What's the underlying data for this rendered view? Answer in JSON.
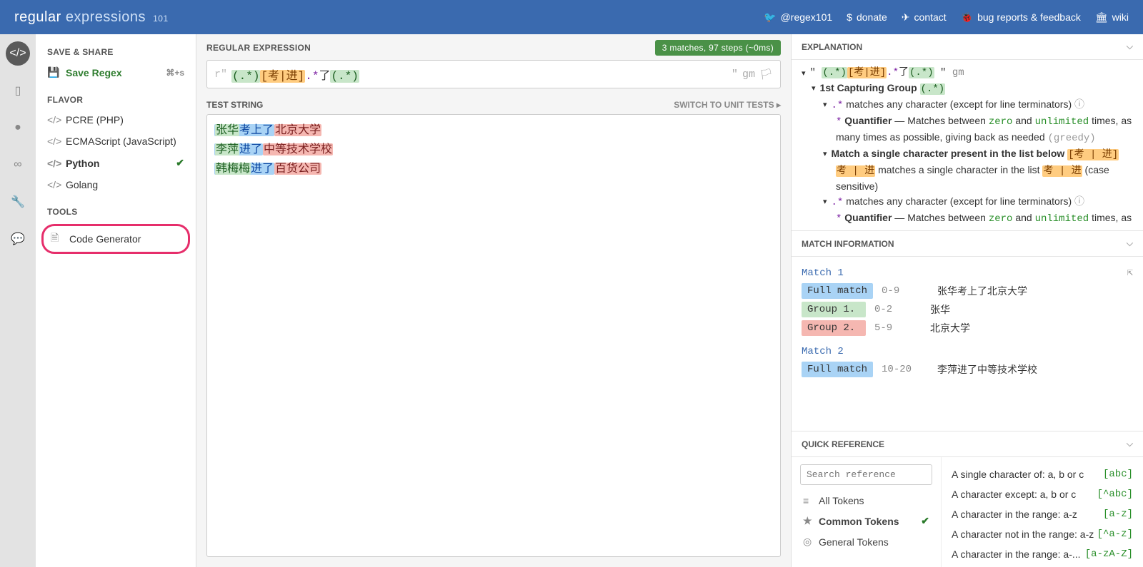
{
  "header": {
    "logo_main": "regular",
    "logo_light": "expressions",
    "logo_sub": "101",
    "links": [
      {
        "icon": "🐦",
        "label": "@regex101"
      },
      {
        "icon": "$",
        "label": "donate"
      },
      {
        "icon": "✈",
        "label": "contact"
      },
      {
        "icon": "🐞",
        "label": "bug reports & feedback"
      },
      {
        "icon": "🏛",
        "label": "wiki"
      }
    ]
  },
  "sidebar": {
    "save_share": "SAVE & SHARE",
    "save_regex": "Save Regex",
    "save_kbd": "⌘+s",
    "flavor": "FLAVOR",
    "flavors": [
      {
        "label": "PCRE (PHP)",
        "active": false
      },
      {
        "label": "ECMAScript (JavaScript)",
        "active": false
      },
      {
        "label": "Python",
        "active": true
      },
      {
        "label": "Golang",
        "active": false
      }
    ],
    "tools": "TOOLS",
    "code_gen": "Code Generator"
  },
  "editor": {
    "title": "REGULAR EXPRESSION",
    "badge": "3 matches, 97 steps (~0ms)",
    "prefix": "r\"",
    "regex_display": {
      "g1": "(.*)",
      "cls": "[考|进]",
      "mid": ".*",
      "lit": "了",
      "g2": "(.*)"
    },
    "flags": "gm",
    "test_title": "TEST STRING",
    "switch": "SWITCH TO UNIT TESTS ▸",
    "test_lines": [
      {
        "g1": "张华",
        "cls": "考",
        "mid": "上",
        "lit": "了",
        "g2": "北京大学"
      },
      {
        "g1": "李萍",
        "cls": "进",
        "mid": "",
        "lit": "了",
        "g2": "中等技术学校"
      },
      {
        "g1": "韩梅梅",
        "cls": "进",
        "mid": "",
        "lit": "了",
        "g2": "百货公司"
      }
    ]
  },
  "explanation": {
    "title": "EXPLANATION",
    "pattern_quoted": "\" (.*)[考|进].*了(.*) \"",
    "gm": "gm",
    "cap1": "1st Capturing Group",
    "cap1_token": "(.*)",
    "dotstar": ".*",
    "dotstar_text": " matches any character (except for line terminators) ",
    "quant": "Quantifier",
    "quant_text1": " — Matches between ",
    "zero": "zero",
    "and": " and ",
    "unlimited": "unlimited",
    "quant_text2": " times, as many times as possible, giving back as needed ",
    "greedy": "(greedy)",
    "charmatch": "Match a single character present in the list below ",
    "cls_token": "[考 | 进]",
    "cls_body": "考 | 进",
    "cls_text1": " matches a single character in the list ",
    "cls_text2": " (case sensitive)"
  },
  "match_info": {
    "title": "MATCH INFORMATION",
    "matches": [
      {
        "name": "Match 1",
        "rows": [
          {
            "label": "Full match",
            "cls": "blue",
            "range": "0-9",
            "text": "张华考上了北京大学"
          },
          {
            "label": "Group 1.",
            "cls": "green",
            "range": "0-2",
            "text": "张华"
          },
          {
            "label": "Group 2.",
            "cls": "red",
            "range": "5-9",
            "text": "北京大学"
          }
        ]
      },
      {
        "name": "Match 2",
        "rows": [
          {
            "label": "Full match",
            "cls": "blue",
            "range": "10-20",
            "text": "李萍进了中等技术学校"
          }
        ]
      }
    ]
  },
  "quickref": {
    "title": "QUICK REFERENCE",
    "search_ph": "Search reference",
    "cats": [
      {
        "icon": "≡",
        "label": "All Tokens",
        "sel": false
      },
      {
        "icon": "★",
        "label": "Common Tokens",
        "sel": true
      },
      {
        "icon": "◎",
        "label": "General Tokens",
        "sel": false
      }
    ],
    "rows": [
      {
        "desc": "A single character of: a, b or c",
        "tok": "[abc]"
      },
      {
        "desc": "A character except: a, b or c",
        "tok": "[^abc]"
      },
      {
        "desc": "A character in the range: a-z",
        "tok": "[a-z]"
      },
      {
        "desc": "A character not in the range: a-z",
        "tok": "[^a-z]"
      },
      {
        "desc": "A character in the range: a-...",
        "tok": "[a-zA-Z]"
      }
    ]
  }
}
